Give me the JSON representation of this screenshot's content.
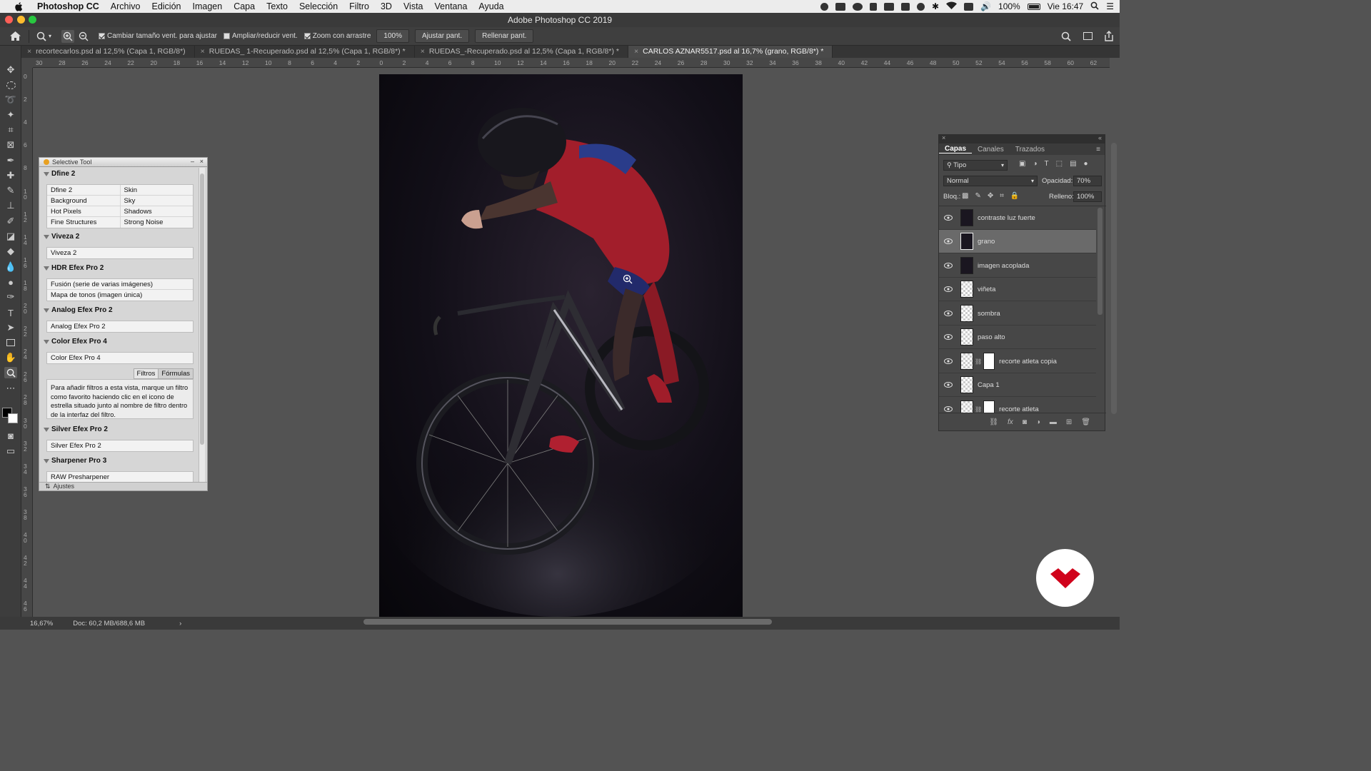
{
  "menubar": {
    "app_name": "Photoshop CC",
    "items": [
      "Archivo",
      "Edición",
      "Imagen",
      "Capa",
      "Texto",
      "Selección",
      "Filtro",
      "3D",
      "Vista",
      "Ventana",
      "Ayuda"
    ],
    "battery": "100%",
    "clock": "Vie 16:47"
  },
  "window": {
    "title": "Adobe Photoshop CC 2019"
  },
  "options": {
    "resize_windows": "Cambiar tamaño vent. para ajustar",
    "resize_windows_checked": true,
    "zoom_all": "Ampliar/reducir vent.",
    "zoom_all_checked": false,
    "scrubby_zoom": "Zoom con arrastre",
    "scrubby_zoom_checked": true,
    "zoom_value": "100%",
    "fit_screen": "Ajustar pant.",
    "fill_screen": "Rellenar pant."
  },
  "tabs": [
    {
      "label": "recortecarlos.psd al 12,5% (Capa 1, RGB/8*)",
      "active": false
    },
    {
      "label": "RUEDAS_ 1-Recuperado.psd al 12,5% (Capa 1, RGB/8*) *",
      "active": false
    },
    {
      "label": "RUEDAS_-Recuperado.psd al 12,5% (Capa 1, RGB/8*) *",
      "active": false
    },
    {
      "label": "CARLOS AZNAR5517.psd al 16,7% (grano, RGB/8*) *",
      "active": true
    }
  ],
  "ruler_h": [
    "30",
    "28",
    "26",
    "24",
    "22",
    "20",
    "18",
    "16",
    "14",
    "12",
    "10",
    "8",
    "6",
    "4",
    "2",
    "0",
    "2",
    "4",
    "6",
    "8",
    "10",
    "12",
    "14",
    "16",
    "18",
    "20",
    "22",
    "24",
    "26",
    "28",
    "30",
    "32",
    "34",
    "36",
    "38",
    "40",
    "42",
    "44",
    "46",
    "48",
    "50",
    "52",
    "54",
    "56",
    "58",
    "60",
    "62"
  ],
  "ruler_v": [
    "0",
    "2",
    "4",
    "6",
    "8",
    "1 0",
    "1 2",
    "1 4",
    "1 6",
    "1 8",
    "2 0",
    "2 2",
    "2 4",
    "2 6",
    "2 8",
    "3 0",
    "3 2",
    "3 4",
    "3 6",
    "3 8",
    "4 0",
    "4 2",
    "4 4",
    "4 6"
  ],
  "selective": {
    "title": "Selective Tool",
    "sections": [
      {
        "title": "Dfine 2",
        "rows": [
          [
            "Dfine 2",
            "Skin"
          ],
          [
            "Background",
            "Sky"
          ],
          [
            "Hot Pixels",
            "Shadows"
          ],
          [
            "Fine Structures",
            "Strong Noise"
          ]
        ]
      },
      {
        "title": "Viveza 2",
        "rows": [
          [
            "Viveza 2"
          ]
        ]
      },
      {
        "title": "HDR Efex Pro 2",
        "rows": [
          [
            "Fusión (serie de varias imágenes)"
          ],
          [
            "Mapa de tonos (imagen única)"
          ]
        ]
      },
      {
        "title": "Analog Efex Pro 2",
        "rows": [
          [
            "Analog Efex Pro 2"
          ]
        ]
      },
      {
        "title": "Color Efex Pro 4",
        "rows": [
          [
            "Color Efex Pro 4"
          ]
        ]
      },
      {
        "title": "Silver Efex Pro 2",
        "rows": [
          [
            "Silver Efex Pro 2"
          ]
        ]
      },
      {
        "title": "Sharpener Pro 3",
        "rows": [
          [
            "RAW Presharpener"
          ]
        ]
      }
    ],
    "tab_filters": "Filtros",
    "tab_formulas": "Fórmulas",
    "help_text": "Para añadir filtros a esta vista, marque un filtro como favorito haciendo clic en el icono de estrella situado junto al nombre de filtro dentro de la interfaz del filtro.",
    "footer": "Ajustes"
  },
  "layers_panel": {
    "tabs": [
      "Capas",
      "Canales",
      "Trazados"
    ],
    "filter_kind": "Tipo",
    "blend_mode": "Normal",
    "opacity_label": "Opacidad:",
    "opacity_value": "70%",
    "lock_label": "Bloq.:",
    "fill_label": "Relleno:",
    "fill_value": "100%",
    "layers": [
      {
        "name": "contraste luz fuerte",
        "thumb": "dark",
        "selected": false,
        "mask": false
      },
      {
        "name": "grano",
        "thumb": "dark",
        "selected": true,
        "mask": false
      },
      {
        "name": "imagen acoplada",
        "thumb": "dark",
        "selected": false,
        "mask": false
      },
      {
        "name": "viñeta",
        "thumb": "checker",
        "selected": false,
        "mask": false
      },
      {
        "name": "sombra",
        "thumb": "checker",
        "selected": false,
        "mask": false
      },
      {
        "name": "paso alto",
        "thumb": "checker",
        "selected": false,
        "mask": false
      },
      {
        "name": "recorte atleta copia",
        "thumb": "checker",
        "selected": false,
        "mask": true
      },
      {
        "name": "Capa 1",
        "thumb": "checker",
        "selected": false,
        "mask": false
      },
      {
        "name": "recorte atleta",
        "thumb": "checker",
        "selected": false,
        "mask": true
      }
    ]
  },
  "status": {
    "zoom": "16,67%",
    "doc": "Doc: 60,2 MB/688,6 MB"
  },
  "colors": {
    "accent_logo": "#d0021b",
    "canvas_bg": "#0b0a10",
    "jersey": "#b3202e"
  }
}
